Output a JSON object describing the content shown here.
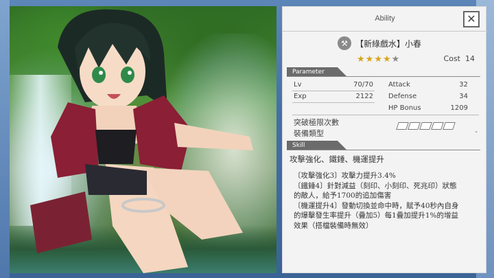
{
  "window": {
    "title": "Ability",
    "close_label": "✕"
  },
  "card": {
    "name": "【新綠戲水】小春",
    "rarity_stars": 5,
    "rarity_filled": 4,
    "cost_label": "Cost",
    "cost_value": "14"
  },
  "parameter": {
    "header": "Parameter",
    "lv_label": "Lv",
    "lv_value": "70/70",
    "exp_label": "Exp",
    "exp_value": "2122",
    "attack_label": "Attack",
    "attack_value": "32",
    "defense_label": "Defense",
    "defense_value": "34",
    "hp_label": "HP Bonus",
    "hp_value": "1209",
    "break_label": "突破極限次數",
    "break_slots": 5,
    "type_label": "裝備類型",
    "type_value": "-"
  },
  "skill": {
    "header": "Skill",
    "summary": "攻擊強化、鐵錘、機運提升",
    "lines": [
      "〔攻擊強化3〕攻擊力提升3.4%",
      "〔鐵錘4〕針對減益（刻印、小刻印、死兆印）狀態",
      "的敵人，給予1700的追加傷害",
      "〔機運提升4〕發動切換並命中時，賦予40秒內自身",
      "的爆擊發生率提升（疊加5）每1疊加提升1%的增益",
      "效果（搭檔裝備時無效）"
    ]
  },
  "colors": {
    "star": "#d8a41a",
    "star_empty": "#8a8a8a",
    "panel": "#f3f3f3",
    "header_tag": "#6b6b6b"
  },
  "icons": {
    "close": "close-icon",
    "weapon": "weapon-type-icon",
    "star": "star-icon"
  }
}
